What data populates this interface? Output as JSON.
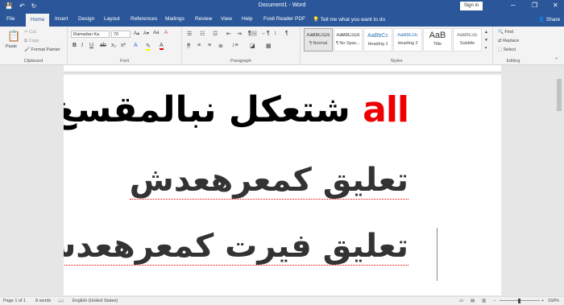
{
  "window": {
    "title": "Document1 - Word",
    "signin": "Sign in",
    "controls": [
      "─",
      "❐",
      "✕"
    ]
  },
  "qat": {
    "save": "💾",
    "undo": "↶",
    "redo": "↻"
  },
  "tabs": [
    {
      "label": "File"
    },
    {
      "label": "Home"
    },
    {
      "label": "Insert"
    },
    {
      "label": "Design"
    },
    {
      "label": "Layout"
    },
    {
      "label": "References"
    },
    {
      "label": "Mailings"
    },
    {
      "label": "Review"
    },
    {
      "label": "View"
    },
    {
      "label": "Help"
    },
    {
      "label": "Foxit Reader PDF"
    }
  ],
  "tell_me": "Tell me what you want to do",
  "share": "Share",
  "clipboard": {
    "group": "Clipboard",
    "paste": "Paste",
    "cut": "Cut",
    "copy": "Copy",
    "format_painter": "Format Painter"
  },
  "font": {
    "group": "Font",
    "name": "Ramadan Ka",
    "size": "70"
  },
  "paragraph": {
    "group": "Paragraph"
  },
  "styles": {
    "group": "Styles",
    "items": [
      {
        "preview": "AaBbCcDc",
        "name": "¶ Normal"
      },
      {
        "preview": "AaBbCcDc",
        "name": "¶ No Spac..."
      },
      {
        "preview": "AaBbCc",
        "name": "Heading 1"
      },
      {
        "preview": "AaBbCcE",
        "name": "Heading 2"
      },
      {
        "preview": "AaB",
        "name": "Title"
      },
      {
        "preview": "AaBbCcE",
        "name": "Subtitle"
      }
    ]
  },
  "editing": {
    "group": "Editing",
    "find": "Find",
    "replace": "Replace",
    "select": "Select"
  },
  "document": {
    "line1": {
      "red": "all",
      "black": "شتعكل نبالمقسغ"
    },
    "line2": "تعليق كمعرهعدش",
    "line3": "تعليق فيرت كمعرهعدش"
  },
  "status": {
    "page": "Page 1 of 1",
    "words": "8 words",
    "language": "English (United States)",
    "zoom": "150%"
  }
}
